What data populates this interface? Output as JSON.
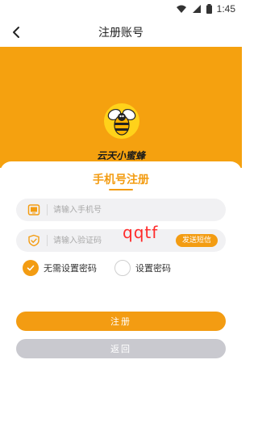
{
  "status_bar": {
    "time": "1:45",
    "icons": [
      "wifi-icon",
      "signal-icon",
      "battery-icon"
    ]
  },
  "nav": {
    "title": "注册账号",
    "back_icon": "chevron-left-icon"
  },
  "hero": {
    "logo_icon": "bee-logo",
    "logo_text": "云天小蜜蜂"
  },
  "form": {
    "title": "手机号注册",
    "phone": {
      "icon": "tablet-icon",
      "placeholder": "请输入手机号",
      "value": ""
    },
    "code": {
      "icon": "shield-check-icon",
      "placeholder": "请输入验证码",
      "value": ""
    },
    "send_sms_label": "发送短信",
    "watermark": "qqtf",
    "options": [
      {
        "label": "无需设置密码",
        "checked": true
      },
      {
        "label": "设置密码",
        "checked": false
      }
    ],
    "register_label": "注册",
    "back_label": "返回"
  },
  "colors": {
    "accent": "#f39c12",
    "hero_bg": "#f5a10f",
    "disabled_button": "#c9c9cf",
    "watermark": "#ff2a2a"
  }
}
